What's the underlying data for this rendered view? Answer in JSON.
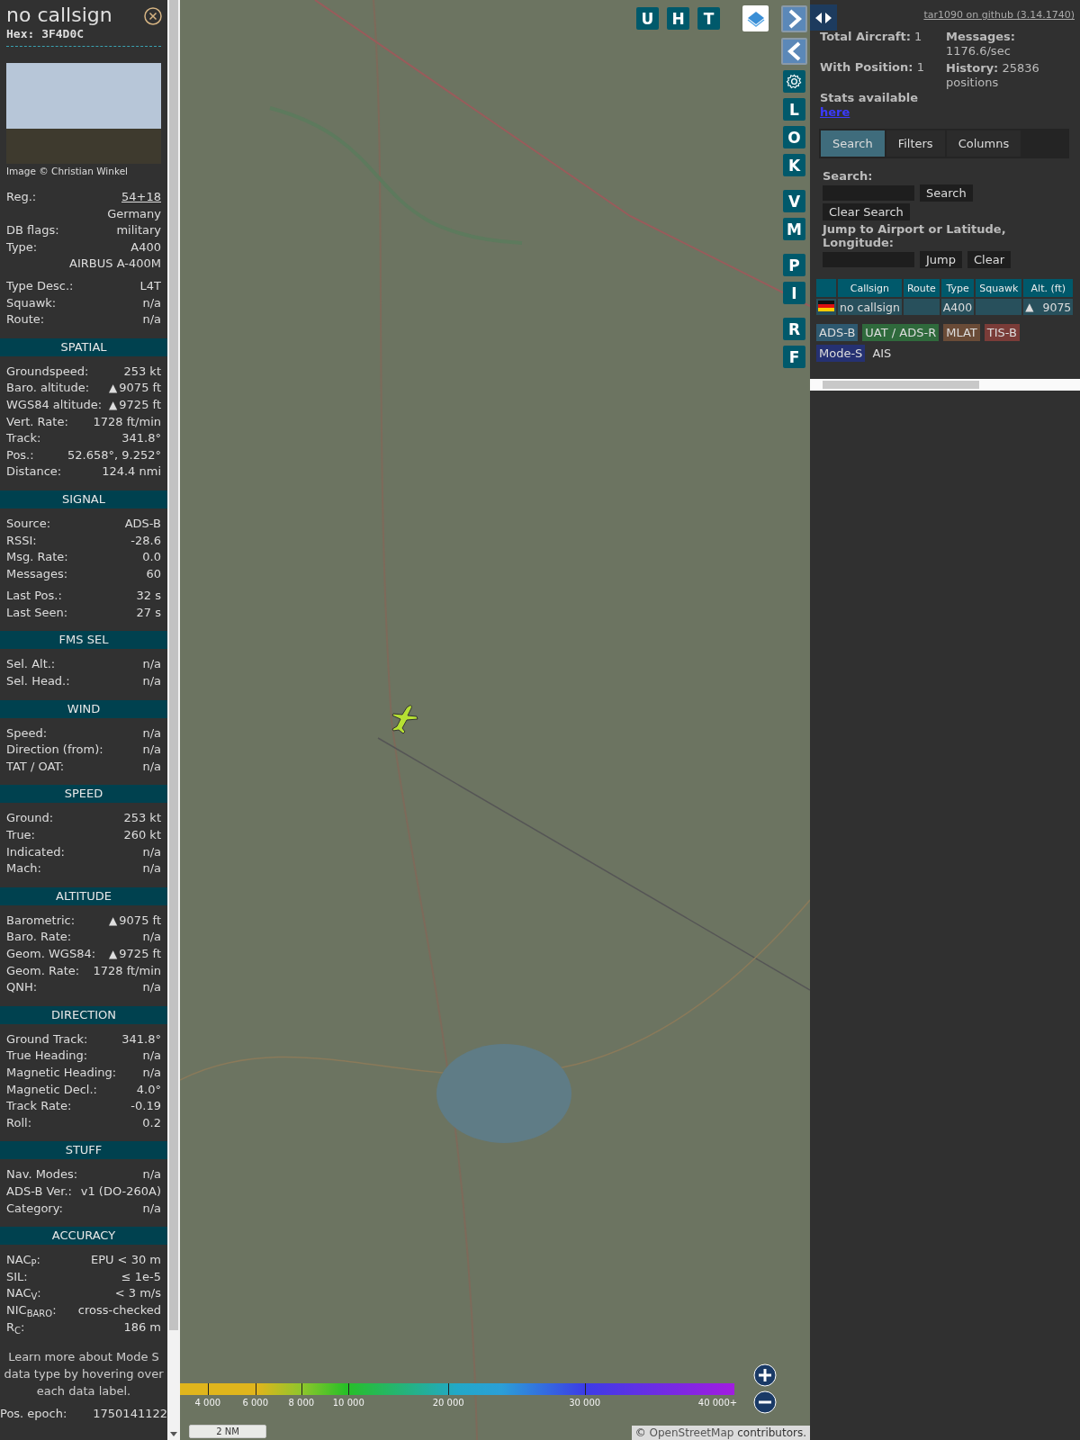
{
  "aircraft_panel": {
    "callsign": "no callsign",
    "hex": "Hex: 3F4D0C",
    "photo_credit": "Image © Christian Winkel",
    "info_groups": [
      [
        {
          "label": "Reg.:",
          "value": "54+18",
          "kind": "link"
        },
        {
          "value": "Germany"
        },
        {
          "label": "DB flags:",
          "value": "military"
        },
        {
          "label": "Type:",
          "value": "A400"
        },
        {
          "value": "AIRBUS A-400M"
        }
      ],
      [
        {
          "label": "Type Desc.:",
          "value": "L4T"
        },
        {
          "label": "Squawk:",
          "value": "n/a"
        },
        {
          "label": "Route:",
          "value": "n/a"
        }
      ]
    ],
    "sections": [
      {
        "title": "SPATIAL",
        "groups": [
          [
            {
              "label": "Groundspeed:",
              "value": "253 kt"
            },
            {
              "label": "Baro. altitude:",
              "value": "9075 ft",
              "trend": "▲"
            },
            {
              "label": "WGS84 altitude:",
              "value": "9725 ft",
              "trend": "▲"
            },
            {
              "label": "Vert. Rate:",
              "value": "1728 ft/min"
            },
            {
              "label": "Track:",
              "value": "341.8°"
            },
            {
              "label": "Pos.:",
              "value": "52.658°, 9.252°"
            },
            {
              "label": "Distance:",
              "value": "124.4 nmi"
            }
          ]
        ]
      },
      {
        "title": "SIGNAL",
        "groups": [
          [
            {
              "label": "Source:",
              "value": "ADS-B"
            },
            {
              "label": "RSSI:",
              "value": "-28.6"
            },
            {
              "label": "Msg. Rate:",
              "value": "0.0"
            },
            {
              "label": "Messages:",
              "value": "60"
            }
          ],
          [
            {
              "label": "Last Pos.:",
              "value": "32 s"
            },
            {
              "label": "Last Seen:",
              "value": "27 s"
            }
          ]
        ]
      },
      {
        "title": "FMS SEL",
        "groups": [
          [
            {
              "label": "Sel. Alt.:",
              "value": "n/a"
            },
            {
              "label": "Sel. Head.:",
              "value": "n/a"
            }
          ]
        ]
      },
      {
        "title": "WIND",
        "groups": [
          [
            {
              "label": "Speed:",
              "value": "n/a"
            },
            {
              "label": "Direction (from):",
              "value": "n/a"
            },
            {
              "label": "TAT / OAT:",
              "value": "n/a"
            }
          ]
        ]
      },
      {
        "title": "SPEED",
        "groups": [
          [
            {
              "label": "Ground:",
              "value": "253 kt"
            },
            {
              "label": "True:",
              "value": "260 kt"
            },
            {
              "label": "Indicated:",
              "value": "n/a"
            },
            {
              "label": "Mach:",
              "value": "n/a"
            }
          ]
        ]
      },
      {
        "title": "ALTITUDE",
        "groups": [
          [
            {
              "label": "Barometric:",
              "value": "9075 ft",
              "trend": "▲"
            },
            {
              "label": "Baro. Rate:",
              "value": "n/a"
            },
            {
              "label": "Geom. WGS84:",
              "value": "9725 ft",
              "trend": "▲"
            },
            {
              "label": "Geom. Rate:",
              "value": "1728 ft/min"
            },
            {
              "label": "QNH:",
              "value": "n/a"
            }
          ]
        ]
      },
      {
        "title": "DIRECTION",
        "groups": [
          [
            {
              "label": "Ground Track:",
              "value": "341.8°"
            },
            {
              "label": "True Heading:",
              "value": "n/a"
            },
            {
              "label": "Magnetic Heading:",
              "value": "n/a"
            },
            {
              "label": "Magnetic Decl.:",
              "value": "4.0°"
            },
            {
              "label": "Track Rate:",
              "value": "-0.19"
            },
            {
              "label": "Roll:",
              "value": "0.2"
            }
          ]
        ]
      },
      {
        "title": "STUFF",
        "groups": [
          [
            {
              "label": "Nav. Modes:",
              "value": "n/a"
            },
            {
              "label": "ADS-B Ver.:",
              "value": "v1 (DO-260A)"
            },
            {
              "label": "Category:",
              "value": "n/a"
            }
          ]
        ]
      },
      {
        "title": "ACCURACY",
        "groups": [
          [
            {
              "label": "NAC$_{P}$:",
              "value": "EPU < 30 m"
            },
            {
              "label": "SIL:",
              "value": "≤ 1e-5"
            },
            {
              "label": "NAC$_{V}$:",
              "value": "< 3 m/s"
            },
            {
              "label": "NIC$_{BARO}$:",
              "value": "cross-checked"
            },
            {
              "label": "R$_{C}$:",
              "value": "186 m"
            }
          ]
        ]
      }
    ],
    "note": "Learn more about Mode S data type by hovering over each data label.",
    "epoch": {
      "label": "Pos. epoch:",
      "value": "1750141122"
    }
  },
  "map": {
    "top_buttons": [
      {
        "kind": "letter",
        "label": "U"
      },
      {
        "kind": "letter",
        "label": "H"
      },
      {
        "kind": "letter",
        "label": "T"
      },
      {
        "kind": "layers"
      }
    ],
    "side_button_groups": [
      [
        {
          "kind": "arrow-right"
        },
        {
          "kind": "arrow-left"
        },
        {
          "kind": "gear"
        },
        {
          "kind": "letter",
          "label": "L"
        },
        {
          "kind": "letter",
          "label": "O"
        },
        {
          "kind": "letter",
          "label": "K"
        }
      ],
      [
        {
          "kind": "letter",
          "label": "V"
        },
        {
          "kind": "letter",
          "label": "M"
        }
      ],
      [
        {
          "kind": "letter",
          "label": "P"
        },
        {
          "kind": "letter",
          "label": "I"
        }
      ],
      [
        {
          "kind": "letter",
          "label": "R"
        },
        {
          "kind": "letter",
          "label": "F"
        }
      ]
    ],
    "altitude_legend": [
      "4 000",
      "6 000",
      "8 000",
      "10 000",
      "20 000",
      "30 000",
      "40 000+"
    ],
    "scale": "2 NM",
    "attribution": {
      "prefix": "©",
      "link": "OpenStreetMap",
      "suffix": "contributors."
    }
  },
  "side_panel": {
    "github_link": "tar1090 on github (3.14.1740)",
    "stats_left": [
      "**Total Aircraft:** 1",
      "**With Position:** 1"
    ],
    "stats_link": {
      "text": "Stats available",
      "link": "here"
    },
    "stats_right": [
      "**Messages:** 1176.6/sec",
      "**History:** 25836 positions"
    ],
    "tabs": [
      {
        "label": "Search",
        "selected": true
      },
      {
        "label": "Filters",
        "selected": false
      },
      {
        "label": "Columns",
        "selected": false
      }
    ],
    "search": {
      "label": "Search:",
      "button": "Search",
      "clear_button": "Clear Search",
      "jump_label": "Jump to Airport or Latitude, Longitude:",
      "jump_button": "Jump",
      "jump_clear_button": "Clear"
    },
    "table": {
      "columns": [
        "Callsign",
        "Route",
        "Type",
        "Squawk",
        "Alt. (ft)"
      ],
      "rows": [
        {
          "callsign": "no callsign",
          "type": "A400",
          "altitude": "9075",
          "trend": "▲"
        }
      ]
    },
    "sources": [
      {
        "label": "ADS-B",
        "color": "#2e5970"
      },
      {
        "label": "UAT / ADS-R",
        "color": "#2f6a3c"
      },
      {
        "label": "MLAT",
        "color": "#6a4b37"
      },
      {
        "label": "TIS-B",
        "color": "#7a3c38"
      },
      {
        "label": "Mode-S",
        "color": "#253172"
      },
      {
        "label": "AIS"
      }
    ]
  }
}
